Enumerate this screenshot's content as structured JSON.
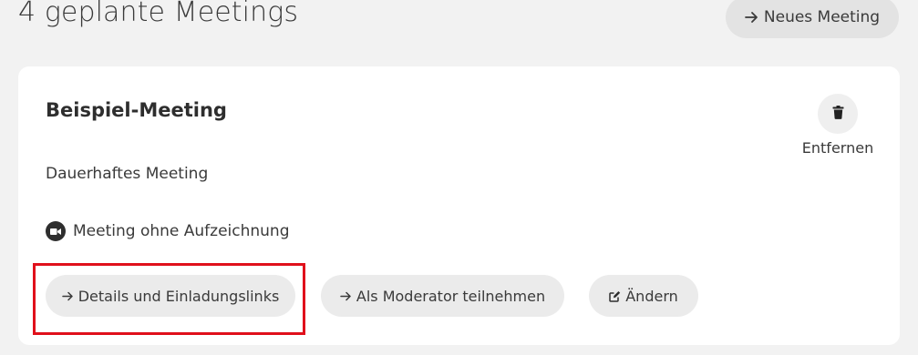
{
  "header": {
    "title": "4 geplante Meetings",
    "new_meeting_label": "Neues Meeting",
    "arrow_icon": "arrow-right-icon"
  },
  "meeting": {
    "title": "Beispiel-Meeting",
    "type": "Dauerhaftes Meeting",
    "recording_status": "Meeting ohne Aufzeichnung",
    "recording_icon": "video-camera-icon",
    "delete_label": "Entfernen",
    "delete_icon": "trash-icon",
    "actions": {
      "details_label": "Details und Einladungslinks",
      "moderator_label": "Als Moderator teilnehmen",
      "edit_label": "Ändern",
      "edit_icon": "edit-icon"
    }
  },
  "colors": {
    "background": "#f2f2f2",
    "card": "#ffffff",
    "pill": "#ebebeb",
    "highlight": "#e0101b"
  }
}
